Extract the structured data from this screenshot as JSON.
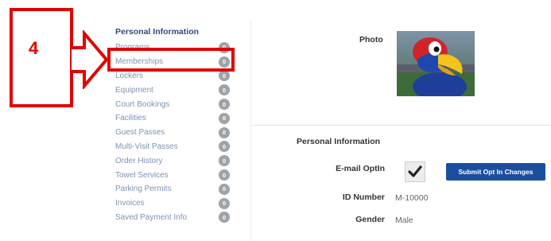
{
  "sidebar": {
    "title": "Personal Information",
    "items": [
      {
        "label": "Programs",
        "count": "0"
      },
      {
        "label": "Memberships",
        "count": "0"
      },
      {
        "label": "Lockers",
        "count": "0"
      },
      {
        "label": "Equipment",
        "count": "0"
      },
      {
        "label": "Court Bookings",
        "count": "0"
      },
      {
        "label": "Facilities",
        "count": "0"
      },
      {
        "label": "Guest Passes",
        "count": "0"
      },
      {
        "label": "Multi-Visit Passes",
        "count": "0"
      },
      {
        "label": "Order History",
        "count": "0"
      },
      {
        "label": "Towel Services",
        "count": "0"
      },
      {
        "label": "Parking Permits",
        "count": "0"
      },
      {
        "label": "Invoices",
        "count": "0"
      },
      {
        "label": "Saved Payment Info",
        "count": "0"
      }
    ]
  },
  "profile": {
    "photo_label": "Photo",
    "section_title": "Personal Information",
    "email_optin_label": "E-mail OptIn",
    "email_optin_checked": true,
    "submit_label": "Submit Opt In Changes",
    "id_label": "ID Number",
    "id_value": "M-10000",
    "gender_label": "Gender",
    "gender_value": "Male"
  },
  "annotation": {
    "step_number": "4",
    "color": "#e10000"
  }
}
